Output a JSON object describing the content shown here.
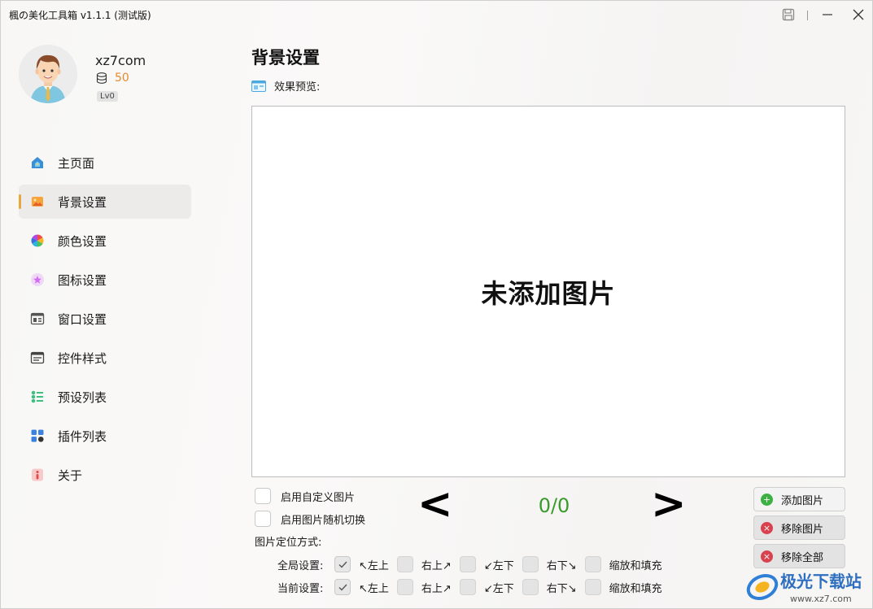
{
  "window": {
    "title": "楓の美化工具箱 v1.1.1 (测试版)"
  },
  "profile": {
    "username": "xz7com",
    "coins": "50",
    "level": "Lv0"
  },
  "nav": {
    "items": [
      {
        "label": "主页面",
        "icon": "home-icon",
        "active": false
      },
      {
        "label": "背景设置",
        "icon": "image-icon",
        "active": true
      },
      {
        "label": "颜色设置",
        "icon": "color-wheel-icon",
        "active": false
      },
      {
        "label": "图标设置",
        "icon": "star-icon",
        "active": false
      },
      {
        "label": "窗口设置",
        "icon": "window-icon",
        "active": false
      },
      {
        "label": "控件样式",
        "icon": "controls-icon",
        "active": false
      },
      {
        "label": "预设列表",
        "icon": "list-icon",
        "active": false
      },
      {
        "label": "插件列表",
        "icon": "plugins-icon",
        "active": false
      },
      {
        "label": "关于",
        "icon": "info-icon",
        "active": false
      }
    ]
  },
  "main": {
    "title": "背景设置",
    "preview_label": "效果预览:",
    "empty_text": "未添加图片",
    "enable_custom": "启用自定义图片",
    "enable_random": "启用图片随机切换",
    "prev_arrow": "<",
    "next_arrow": ">",
    "counter": "0/0",
    "position_label": "图片定位方式:",
    "position_rows": [
      {
        "label": "全局设置:",
        "options": [
          "↖左上",
          "右上↗",
          "↙左下",
          "右下↘",
          "缩放和填充"
        ]
      },
      {
        "label": "当前设置:",
        "options": [
          "↖左上",
          "右上↗",
          "↙左下",
          "右下↘",
          "缩放和填充"
        ]
      }
    ],
    "buttons": {
      "add": "添加图片",
      "remove": "移除图片",
      "remove_all": "移除全部"
    }
  },
  "colors": {
    "accent": "#e4a93a",
    "counter": "#3a9a2c",
    "coins": "#e68a2e",
    "add": "#3cb043",
    "remove": "#d9414e"
  },
  "watermark": {
    "text": "极光下载站",
    "url_text": "www.xz7.com"
  }
}
